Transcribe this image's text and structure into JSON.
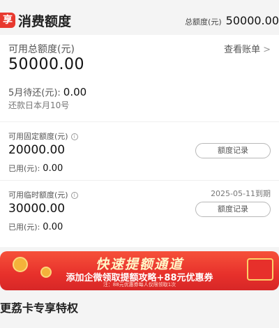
{
  "header": {
    "logo_text": "享",
    "title": "消费额度",
    "total_label": "总额度(元)",
    "total_value": "50000.00"
  },
  "main": {
    "available_label": "可用总额度(元)",
    "available_value": "50000.00",
    "bill_link": "查看账单",
    "due_label": "5月待还(元):",
    "due_value": "0.00",
    "repay_day": "还款日本月10号"
  },
  "fixed": {
    "label": "可用固定额度(元)",
    "value": "20000.00",
    "used_label": "已用(元):",
    "used_value": "0.00",
    "record_button": "额度记录"
  },
  "temporary": {
    "label": "可用临时额度(元)",
    "value": "30000.00",
    "expire": "2025-05-11到期",
    "used_label": "已用(元):",
    "used_value": "0.00",
    "record_button": "额度记录"
  },
  "banner": {
    "title": "快速提额通道",
    "subtitle": "添加企微领取提额攻略+88元优惠券",
    "note": "注：88元优惠券每人仅限领取1次",
    "colors": {
      "primary": "#e7302b",
      "gold": "#f4b23a"
    }
  },
  "privileges_title": "更荔卡专享特权"
}
